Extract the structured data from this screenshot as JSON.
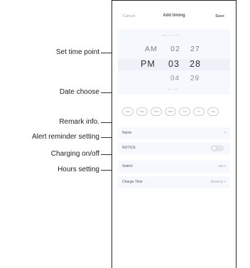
{
  "labels": {
    "time": "Set time point",
    "date": "Date choose",
    "remark": "Remark info.",
    "alert": "Alert reminder setting",
    "charging": "Charging on/off",
    "hours": "Hours setting"
  },
  "screen": {
    "header": {
      "cancel": "Cancel",
      "title": "Add timing",
      "save": "Save"
    },
    "picker": {
      "top_faint": "AM 01 26",
      "row1": {
        "period": "AM",
        "hour": "02",
        "minute": "27"
      },
      "selected": {
        "period": "PM",
        "hour": "03",
        "minute": "28"
      },
      "row3": {
        "hour": "04",
        "minute": "29"
      },
      "bottom_faint": "05 30"
    },
    "days": [
      "Sun",
      "Mon",
      "Tues",
      "Wed",
      "Thu",
      "Fri",
      "Sat"
    ],
    "rows": {
      "name": {
        "label": "Name",
        "value": ">"
      },
      "notice": {
        "label": "NOTICE"
      },
      "switch": {
        "label": "Switch",
        "value": "ON >"
      },
      "charge_time": {
        "label": "Charge Time",
        "value": "00:00:11 >"
      }
    }
  }
}
